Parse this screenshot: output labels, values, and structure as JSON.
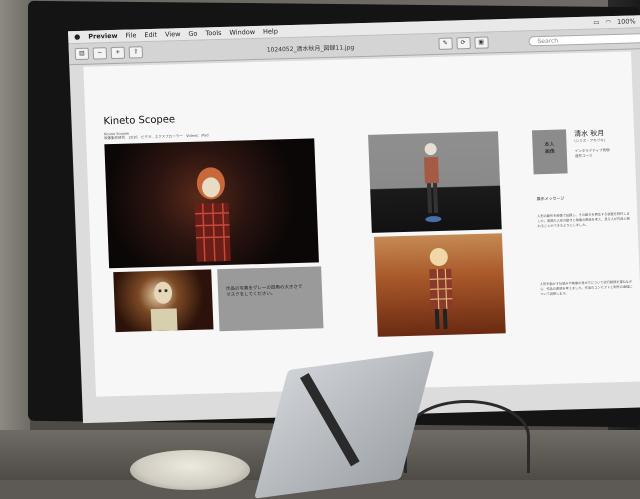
{
  "menubar": {
    "apple": "",
    "app": "Preview",
    "items": [
      "File",
      "Edit",
      "View",
      "Go",
      "Tools",
      "Window",
      "Help"
    ],
    "battery": "100%",
    "right_icons": [
      "display-icon",
      "wifi-icon",
      "battery-icon"
    ]
  },
  "window": {
    "title": "1024052_清水秋月_図録11.jpg",
    "search_placeholder": "Search"
  },
  "page": {
    "title": "Kineto Scopee",
    "subtitle_line1": "Kineto Scopee",
    "subtitle_line2": "映像動作研究　2016　ビデオ、エクスプローラー　Videos：iPad",
    "gray_box_text": "作品の写真をグレーの四角の大きさで\nマスクをしてください。",
    "side_box_text": "本人\n画像",
    "artist_name": "清水 秋月",
    "artist_name_en": "(シミズ・アキヅキ)",
    "artist_role": "インタラクティブ表現\n造形コース",
    "side_heading": "展示メッセージ",
    "side_text_1": "人形の動作を映像で記録し、その動きを再生する装置を制作しました。実際の人形の動きと映像の関係を考え、見る人が作品と関わることができるようにしました。",
    "side_text_2": "人形を動かす仕組みや映像の見せ方について試行錯誤を重ねながら、作品の表現を考えました。作品のコンセプトと制作の過程について説明します。"
  }
}
